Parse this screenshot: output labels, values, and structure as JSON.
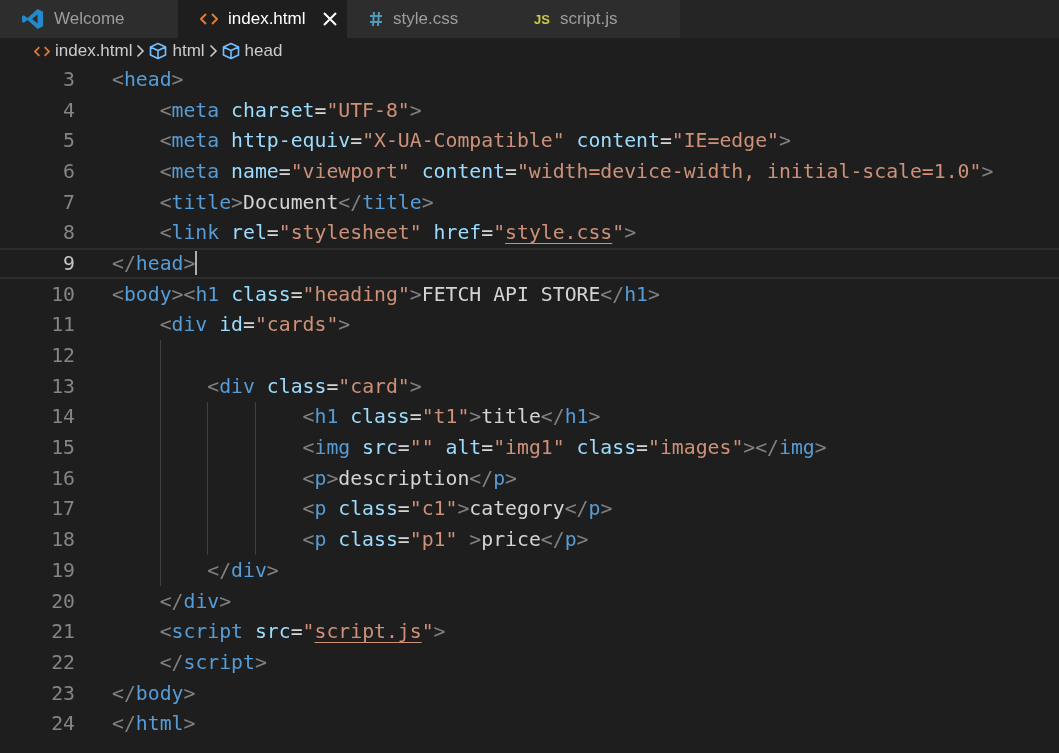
{
  "tabs": [
    {
      "kind": "welcome",
      "label": "Welcome",
      "selected": false
    },
    {
      "kind": "html",
      "label": "index.html",
      "selected": true
    },
    {
      "kind": "css",
      "label": "style.css",
      "selected": false
    },
    {
      "kind": "js",
      "label": "script.js",
      "icon_text": "JS",
      "selected": false
    }
  ],
  "breadcrumb": [
    {
      "kind": "file",
      "label": "index.html"
    },
    {
      "kind": "element",
      "label": "html"
    },
    {
      "kind": "element",
      "label": "head"
    }
  ],
  "lines": [
    {
      "number": "3",
      "current": false,
      "tokens": [
        {
          "kind": "punct",
          "text": "<"
        },
        {
          "kind": "tag",
          "text": "head"
        },
        {
          "kind": "punct",
          "text": ">"
        }
      ]
    },
    {
      "number": "4",
      "current": false,
      "tokens": [
        {
          "kind": "punct",
          "text": "    <"
        },
        {
          "kind": "tag",
          "text": "meta"
        },
        {
          "kind": "attr",
          "text": " charset"
        },
        {
          "kind": "text",
          "text": "="
        },
        {
          "kind": "string",
          "text": "\"UTF-8\""
        },
        {
          "kind": "punct",
          "text": ">"
        }
      ]
    },
    {
      "number": "5",
      "current": false,
      "tokens": [
        {
          "kind": "punct",
          "text": "    <"
        },
        {
          "kind": "tag",
          "text": "meta"
        },
        {
          "kind": "attr",
          "text": " http-equiv"
        },
        {
          "kind": "text",
          "text": "="
        },
        {
          "kind": "string",
          "text": "\"X-UA-Compatible\""
        },
        {
          "kind": "attr",
          "text": " content"
        },
        {
          "kind": "text",
          "text": "="
        },
        {
          "kind": "string",
          "text": "\"IE=edge\""
        },
        {
          "kind": "punct",
          "text": ">"
        }
      ]
    },
    {
      "number": "6",
      "current": false,
      "tokens": [
        {
          "kind": "punct",
          "text": "    <"
        },
        {
          "kind": "tag",
          "text": "meta"
        },
        {
          "kind": "attr",
          "text": " name"
        },
        {
          "kind": "text",
          "text": "="
        },
        {
          "kind": "string",
          "text": "\"viewport\""
        },
        {
          "kind": "attr",
          "text": " content"
        },
        {
          "kind": "text",
          "text": "="
        },
        {
          "kind": "string",
          "text": "\"width=device-width, initial-scale=1.0\""
        },
        {
          "kind": "punct",
          "text": ">"
        }
      ]
    },
    {
      "number": "7",
      "current": false,
      "tokens": [
        {
          "kind": "punct",
          "text": "    <"
        },
        {
          "kind": "tag",
          "text": "title"
        },
        {
          "kind": "punct",
          "text": ">"
        },
        {
          "kind": "text",
          "text": "Document"
        },
        {
          "kind": "punct",
          "text": "</"
        },
        {
          "kind": "tag",
          "text": "title"
        },
        {
          "kind": "punct",
          "text": ">"
        }
      ]
    },
    {
      "number": "8",
      "current": false,
      "tokens": [
        {
          "kind": "punct",
          "text": "    <"
        },
        {
          "kind": "tag",
          "text": "link"
        },
        {
          "kind": "attr",
          "text": " rel"
        },
        {
          "kind": "text",
          "text": "="
        },
        {
          "kind": "string",
          "text": "\"stylesheet\""
        },
        {
          "kind": "attr",
          "text": " href"
        },
        {
          "kind": "text",
          "text": "="
        },
        {
          "kind": "string",
          "text": "\""
        },
        {
          "kind": "link",
          "text": "style.css"
        },
        {
          "kind": "string",
          "text": "\""
        },
        {
          "kind": "punct",
          "text": ">"
        }
      ]
    },
    {
      "number": "9",
      "current": true,
      "tokens": [
        {
          "kind": "punct",
          "text": "</"
        },
        {
          "kind": "tag",
          "text": "head"
        },
        {
          "kind": "punct",
          "text": ">"
        }
      ]
    },
    {
      "number": "10",
      "current": false,
      "tokens": [
        {
          "kind": "punct",
          "text": "<"
        },
        {
          "kind": "tag",
          "text": "body"
        },
        {
          "kind": "punct",
          "text": "><"
        },
        {
          "kind": "tag",
          "text": "h1"
        },
        {
          "kind": "attr",
          "text": " class"
        },
        {
          "kind": "text",
          "text": "="
        },
        {
          "kind": "string",
          "text": "\"heading\""
        },
        {
          "kind": "punct",
          "text": ">"
        },
        {
          "kind": "text",
          "text": "FETCH API STORE"
        },
        {
          "kind": "punct",
          "text": "</"
        },
        {
          "kind": "tag",
          "text": "h1"
        },
        {
          "kind": "punct",
          "text": ">"
        }
      ]
    },
    {
      "number": "11",
      "current": false,
      "tokens": [
        {
          "kind": "punct",
          "text": "    <"
        },
        {
          "kind": "tag",
          "text": "div"
        },
        {
          "kind": "attr",
          "text": " id"
        },
        {
          "kind": "text",
          "text": "="
        },
        {
          "kind": "string",
          "text": "\"cards\""
        },
        {
          "kind": "punct",
          "text": ">"
        }
      ]
    },
    {
      "number": "12",
      "current": false
    },
    {
      "number": "13",
      "current": false,
      "tokens": [
        {
          "kind": "punct",
          "text": "        <"
        },
        {
          "kind": "tag",
          "text": "div"
        },
        {
          "kind": "attr",
          "text": " class"
        },
        {
          "kind": "text",
          "text": "="
        },
        {
          "kind": "string",
          "text": "\"card\""
        },
        {
          "kind": "punct",
          "text": ">"
        }
      ]
    },
    {
      "number": "14",
      "current": false,
      "tokens": [
        {
          "kind": "punct",
          "text": "                <"
        },
        {
          "kind": "tag",
          "text": "h1"
        },
        {
          "kind": "attr",
          "text": " class"
        },
        {
          "kind": "text",
          "text": "="
        },
        {
          "kind": "string",
          "text": "\"t1\""
        },
        {
          "kind": "punct",
          "text": ">"
        },
        {
          "kind": "text",
          "text": "title"
        },
        {
          "kind": "punct",
          "text": "</"
        },
        {
          "kind": "tag",
          "text": "h1"
        },
        {
          "kind": "punct",
          "text": ">"
        }
      ]
    },
    {
      "number": "15",
      "current": false,
      "tokens": [
        {
          "kind": "punct",
          "text": "                <"
        },
        {
          "kind": "tag",
          "text": "img"
        },
        {
          "kind": "attr",
          "text": " src"
        },
        {
          "kind": "text",
          "text": "="
        },
        {
          "kind": "string",
          "text": "\"\""
        },
        {
          "kind": "attr",
          "text": " alt"
        },
        {
          "kind": "text",
          "text": "="
        },
        {
          "kind": "string",
          "text": "\"img1\""
        },
        {
          "kind": "attr",
          "text": " class"
        },
        {
          "kind": "text",
          "text": "="
        },
        {
          "kind": "string",
          "text": "\"images\""
        },
        {
          "kind": "punct",
          "text": "></"
        },
        {
          "kind": "tag",
          "text": "img"
        },
        {
          "kind": "punct",
          "text": ">"
        }
      ]
    },
    {
      "number": "16",
      "current": false,
      "tokens": [
        {
          "kind": "punct",
          "text": "                <"
        },
        {
          "kind": "tag",
          "text": "p"
        },
        {
          "kind": "punct",
          "text": ">"
        },
        {
          "kind": "text",
          "text": "description"
        },
        {
          "kind": "punct",
          "text": "</"
        },
        {
          "kind": "tag",
          "text": "p"
        },
        {
          "kind": "punct",
          "text": ">"
        }
      ]
    },
    {
      "number": "17",
      "current": false,
      "tokens": [
        {
          "kind": "punct",
          "text": "                <"
        },
        {
          "kind": "tag",
          "text": "p"
        },
        {
          "kind": "attr",
          "text": " class"
        },
        {
          "kind": "text",
          "text": "="
        },
        {
          "kind": "string",
          "text": "\"c1\""
        },
        {
          "kind": "punct",
          "text": ">"
        },
        {
          "kind": "text",
          "text": "category"
        },
        {
          "kind": "punct",
          "text": "</"
        },
        {
          "kind": "tag",
          "text": "p"
        },
        {
          "kind": "punct",
          "text": ">"
        }
      ]
    },
    {
      "number": "18",
      "current": false,
      "tokens": [
        {
          "kind": "punct",
          "text": "                <"
        },
        {
          "kind": "tag",
          "text": "p"
        },
        {
          "kind": "attr",
          "text": " class"
        },
        {
          "kind": "text",
          "text": "="
        },
        {
          "kind": "string",
          "text": "\"p1\""
        },
        {
          "kind": "punct",
          "text": " >"
        },
        {
          "kind": "text",
          "text": "price"
        },
        {
          "kind": "punct",
          "text": "</"
        },
        {
          "kind": "tag",
          "text": "p"
        },
        {
          "kind": "punct",
          "text": ">"
        }
      ]
    },
    {
      "number": "19",
      "current": false,
      "tokens": [
        {
          "kind": "punct",
          "text": "        </"
        },
        {
          "kind": "tag",
          "text": "div"
        },
        {
          "kind": "punct",
          "text": ">"
        }
      ]
    },
    {
      "number": "20",
      "current": false,
      "tokens": [
        {
          "kind": "punct",
          "text": "    </"
        },
        {
          "kind": "tag",
          "text": "div"
        },
        {
          "kind": "punct",
          "text": ">"
        }
      ]
    },
    {
      "number": "21",
      "current": false,
      "tokens": [
        {
          "kind": "punct",
          "text": "    <"
        },
        {
          "kind": "tag",
          "text": "script"
        },
        {
          "kind": "attr",
          "text": " src"
        },
        {
          "kind": "text",
          "text": "="
        },
        {
          "kind": "string",
          "text": "\""
        },
        {
          "kind": "link",
          "text": "script.js"
        },
        {
          "kind": "string",
          "text": "\""
        },
        {
          "kind": "punct",
          "text": ">"
        }
      ]
    },
    {
      "number": "22",
      "current": false,
      "tokens": [
        {
          "kind": "punct",
          "text": "    </"
        },
        {
          "kind": "tag",
          "text": "script"
        },
        {
          "kind": "punct",
          "text": ">"
        }
      ]
    },
    {
      "number": "23",
      "current": false,
      "tokens": [
        {
          "kind": "punct",
          "text": "</"
        },
        {
          "kind": "tag",
          "text": "body"
        },
        {
          "kind": "punct",
          "text": ">"
        }
      ]
    },
    {
      "number": "24",
      "current": false,
      "tokens": [
        {
          "kind": "punct",
          "text": "</"
        },
        {
          "kind": "tag",
          "text": "html"
        },
        {
          "kind": "punct",
          "text": ">"
        }
      ]
    }
  ]
}
